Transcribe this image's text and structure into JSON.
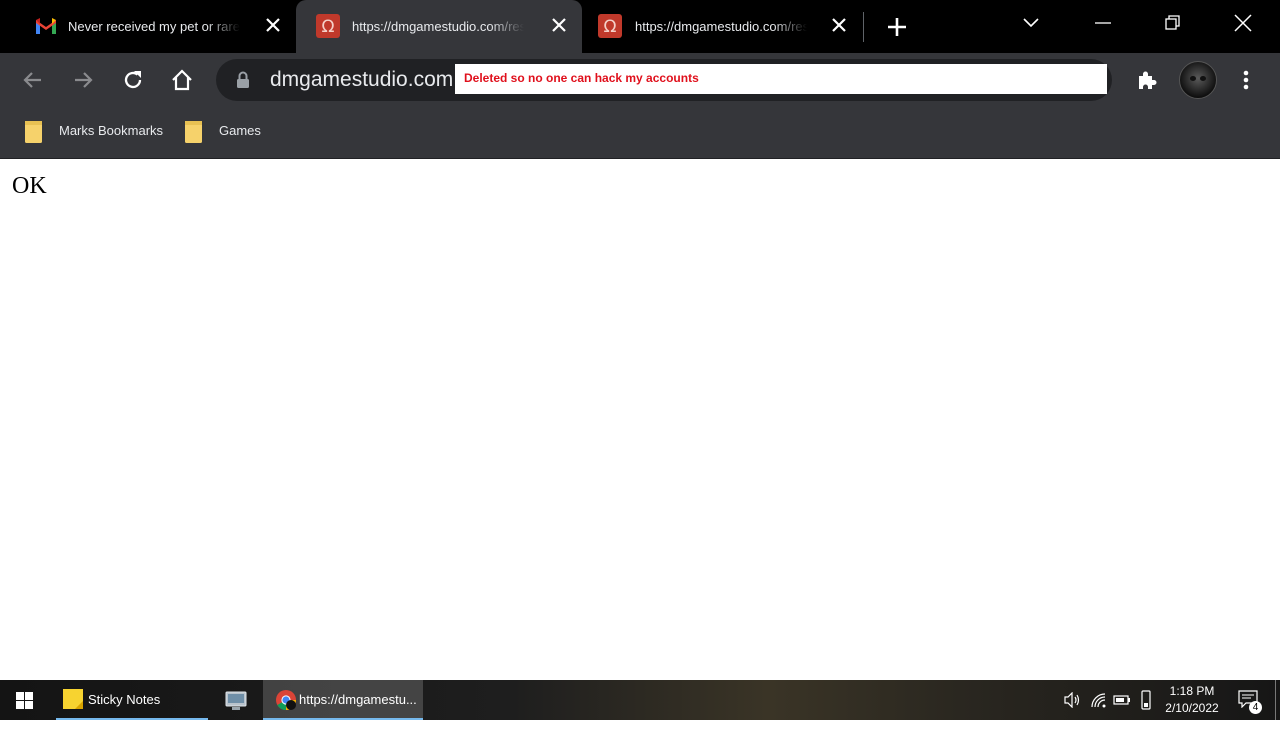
{
  "browser": {
    "tabs": [
      {
        "title": "Never received my pet or rare skin",
        "favicon": "gmail-icon",
        "active": false
      },
      {
        "title": "https://dmgamestudio.com/reset",
        "favicon": "omega-icon",
        "active": true
      },
      {
        "title": "https://dmgamestudio.com/reset",
        "favicon": "omega-icon",
        "active": false
      }
    ],
    "omnibox": {
      "url": "dmgamestudio.com",
      "redaction_note": "Deleted so no one can hack my accounts"
    },
    "bookmarks": [
      {
        "label": "Marks Bookmarks",
        "icon": "folder-icon"
      },
      {
        "label": "Games",
        "icon": "folder-icon"
      }
    ]
  },
  "page": {
    "body_text": "OK"
  },
  "taskbar": {
    "apps": [
      {
        "label": "Sticky Notes",
        "icon": "sticky-notes-icon"
      },
      {
        "label": "",
        "icon": "control-panel-icon"
      },
      {
        "label": "https://dmgamestu...",
        "icon": "chrome-icon"
      }
    ],
    "time": "1:18 PM",
    "date": "2/10/2022",
    "notification_count": "4"
  },
  "colors": {
    "redaction_text": "#e0101c",
    "chrome_dark": "#35363a",
    "taskbar_active_underline": "#76b9ed"
  }
}
